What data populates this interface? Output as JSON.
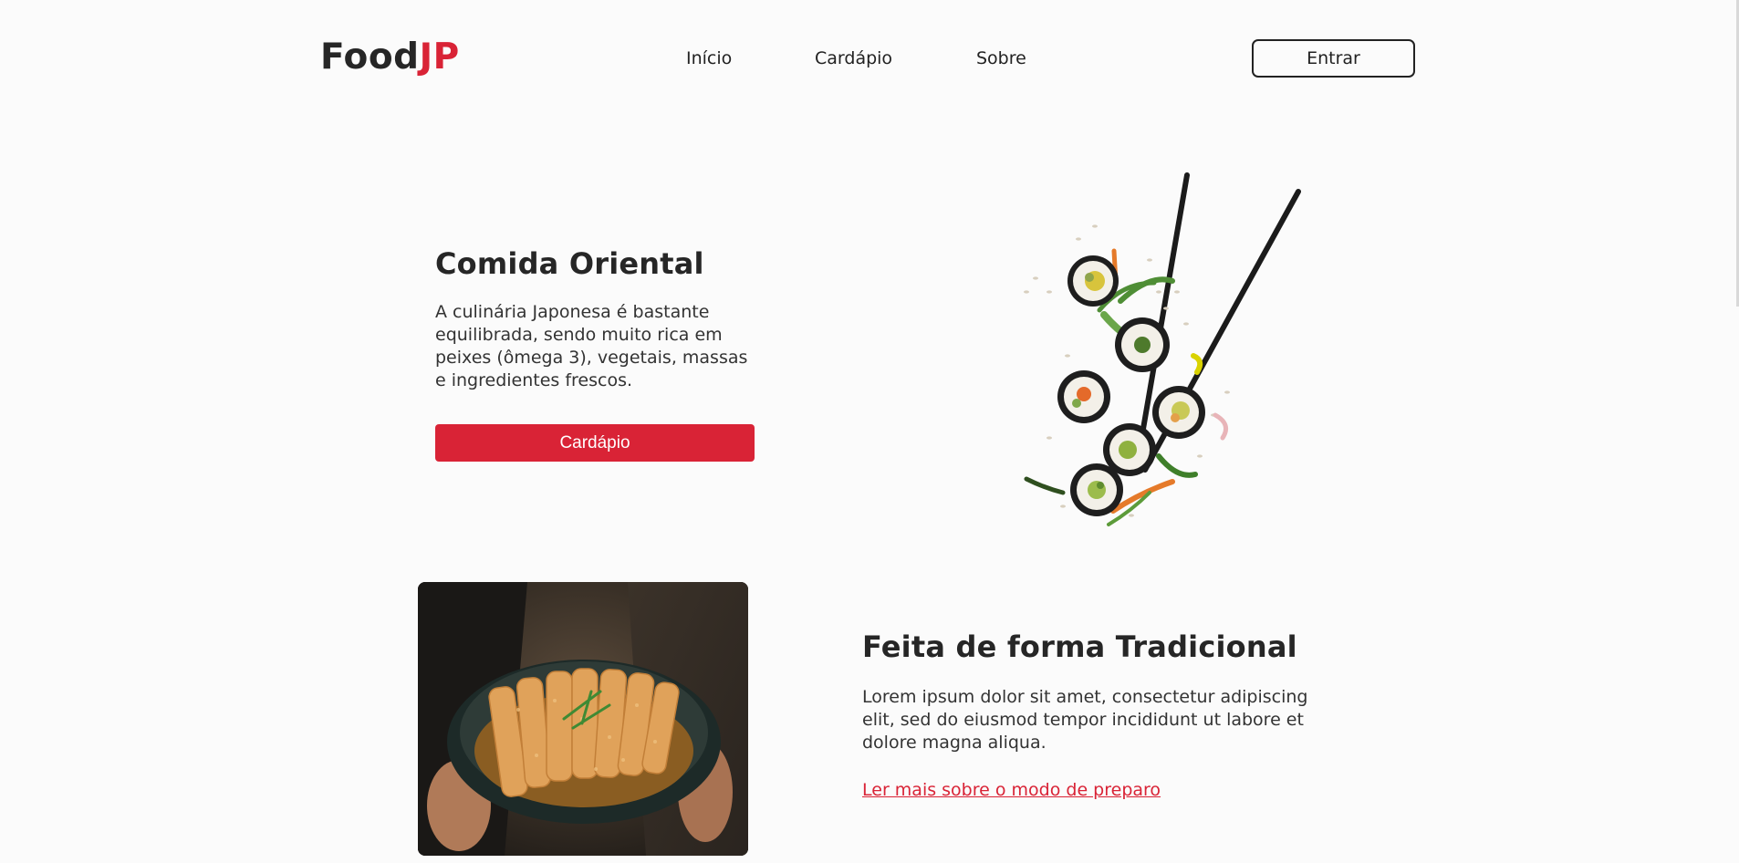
{
  "header": {
    "logo_main": "Food",
    "logo_accent": "JP",
    "nav": [
      "Início",
      "Cardápio",
      "Sobre"
    ],
    "login_label": "Entrar"
  },
  "hero": {
    "title": "Comida Oriental",
    "text": "A culinária Japonesa é bastante equilibrada, sendo muito rica em peixes (ômega 3), vegetais, massas e ingredientes frescos.",
    "button_label": "Cardápio"
  },
  "feature": {
    "title": "Feita de forma Tradicional",
    "text": "Lorem ipsum dolor sit amet, consectetur adipiscing elit, sed do eiusmod tempor incididunt ut labore et dolore magna aliqua.",
    "link_label": "Ler mais sobre o modo de preparo"
  },
  "colors": {
    "accent": "#d92336",
    "text": "#262626",
    "background": "#fbfbfb"
  }
}
